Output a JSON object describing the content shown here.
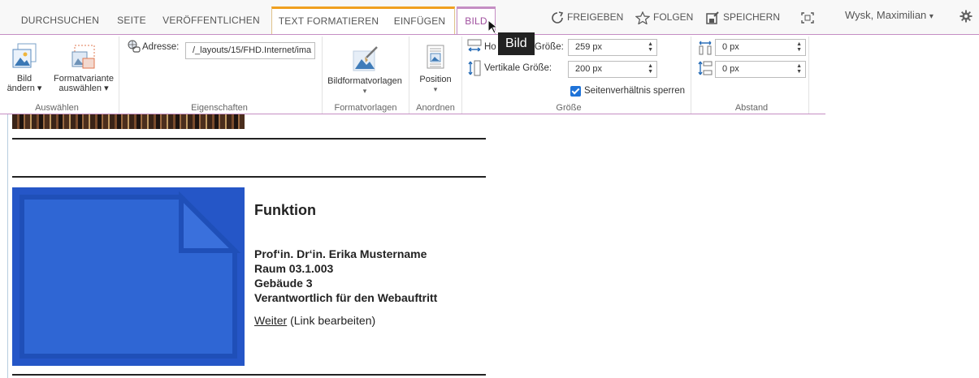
{
  "tabs": [
    "DURCHSUCHEN",
    "SEITE",
    "VERÖFFENTLICHEN",
    "TEXT FORMATIEREN",
    "EINFÜGEN",
    "BILD"
  ],
  "tooltip": "Bild",
  "top_actions": {
    "share": "FREIGEBEN",
    "follow": "FOLGEN",
    "save": "SPEICHERN"
  },
  "user": {
    "name": "Wysk, Maximilian",
    "caret": "▾"
  },
  "ribbon": {
    "change_picture": {
      "line1": "Bild",
      "line2": "ändern",
      "caret": "▾"
    },
    "format_variant": {
      "line1": "Formatvariante",
      "line2": "auswählen",
      "caret": "▾"
    },
    "address_label": "Adresse:",
    "address_value": "/_layouts/15/FHD.Internet/ima",
    "image_styles": {
      "label": "Bildformatvorlagen",
      "caret": "▾"
    },
    "position": {
      "label": "Position",
      "caret": "▾"
    },
    "horizontal_label_start": "Ho",
    "horizontal_label_end": "Größe:",
    "horizontal_value": "259 px",
    "vertical_label": "Vertikale Größe:",
    "vertical_value": "200 px",
    "lock_ratio_label": "Seitenverhältnis sperren",
    "lock_ratio_checked": true,
    "spacing_h_value": "0 px",
    "spacing_v_value": "0 px",
    "groups": {
      "select": "Auswählen",
      "properties": "Eigenschaften",
      "styles": "Formatvorlagen",
      "arrange": "Anordnen",
      "size": "Größe",
      "spacing": "Abstand"
    }
  },
  "content": {
    "title": "Funktion",
    "lines": [
      "Prof‘in. Dr‘in. Erika Mustername",
      "Raum 03.1.003",
      "Gebäude 3",
      "Verantwortlich für den Webauftritt"
    ],
    "link_text": "Weiter",
    "link_note": "(Link bearbeiten)"
  },
  "colors": {
    "accent": "#a0509f",
    "context_tab": "#f0a020",
    "placeholder_blue": "#2556c7",
    "checkbox": "#1f73d8"
  }
}
